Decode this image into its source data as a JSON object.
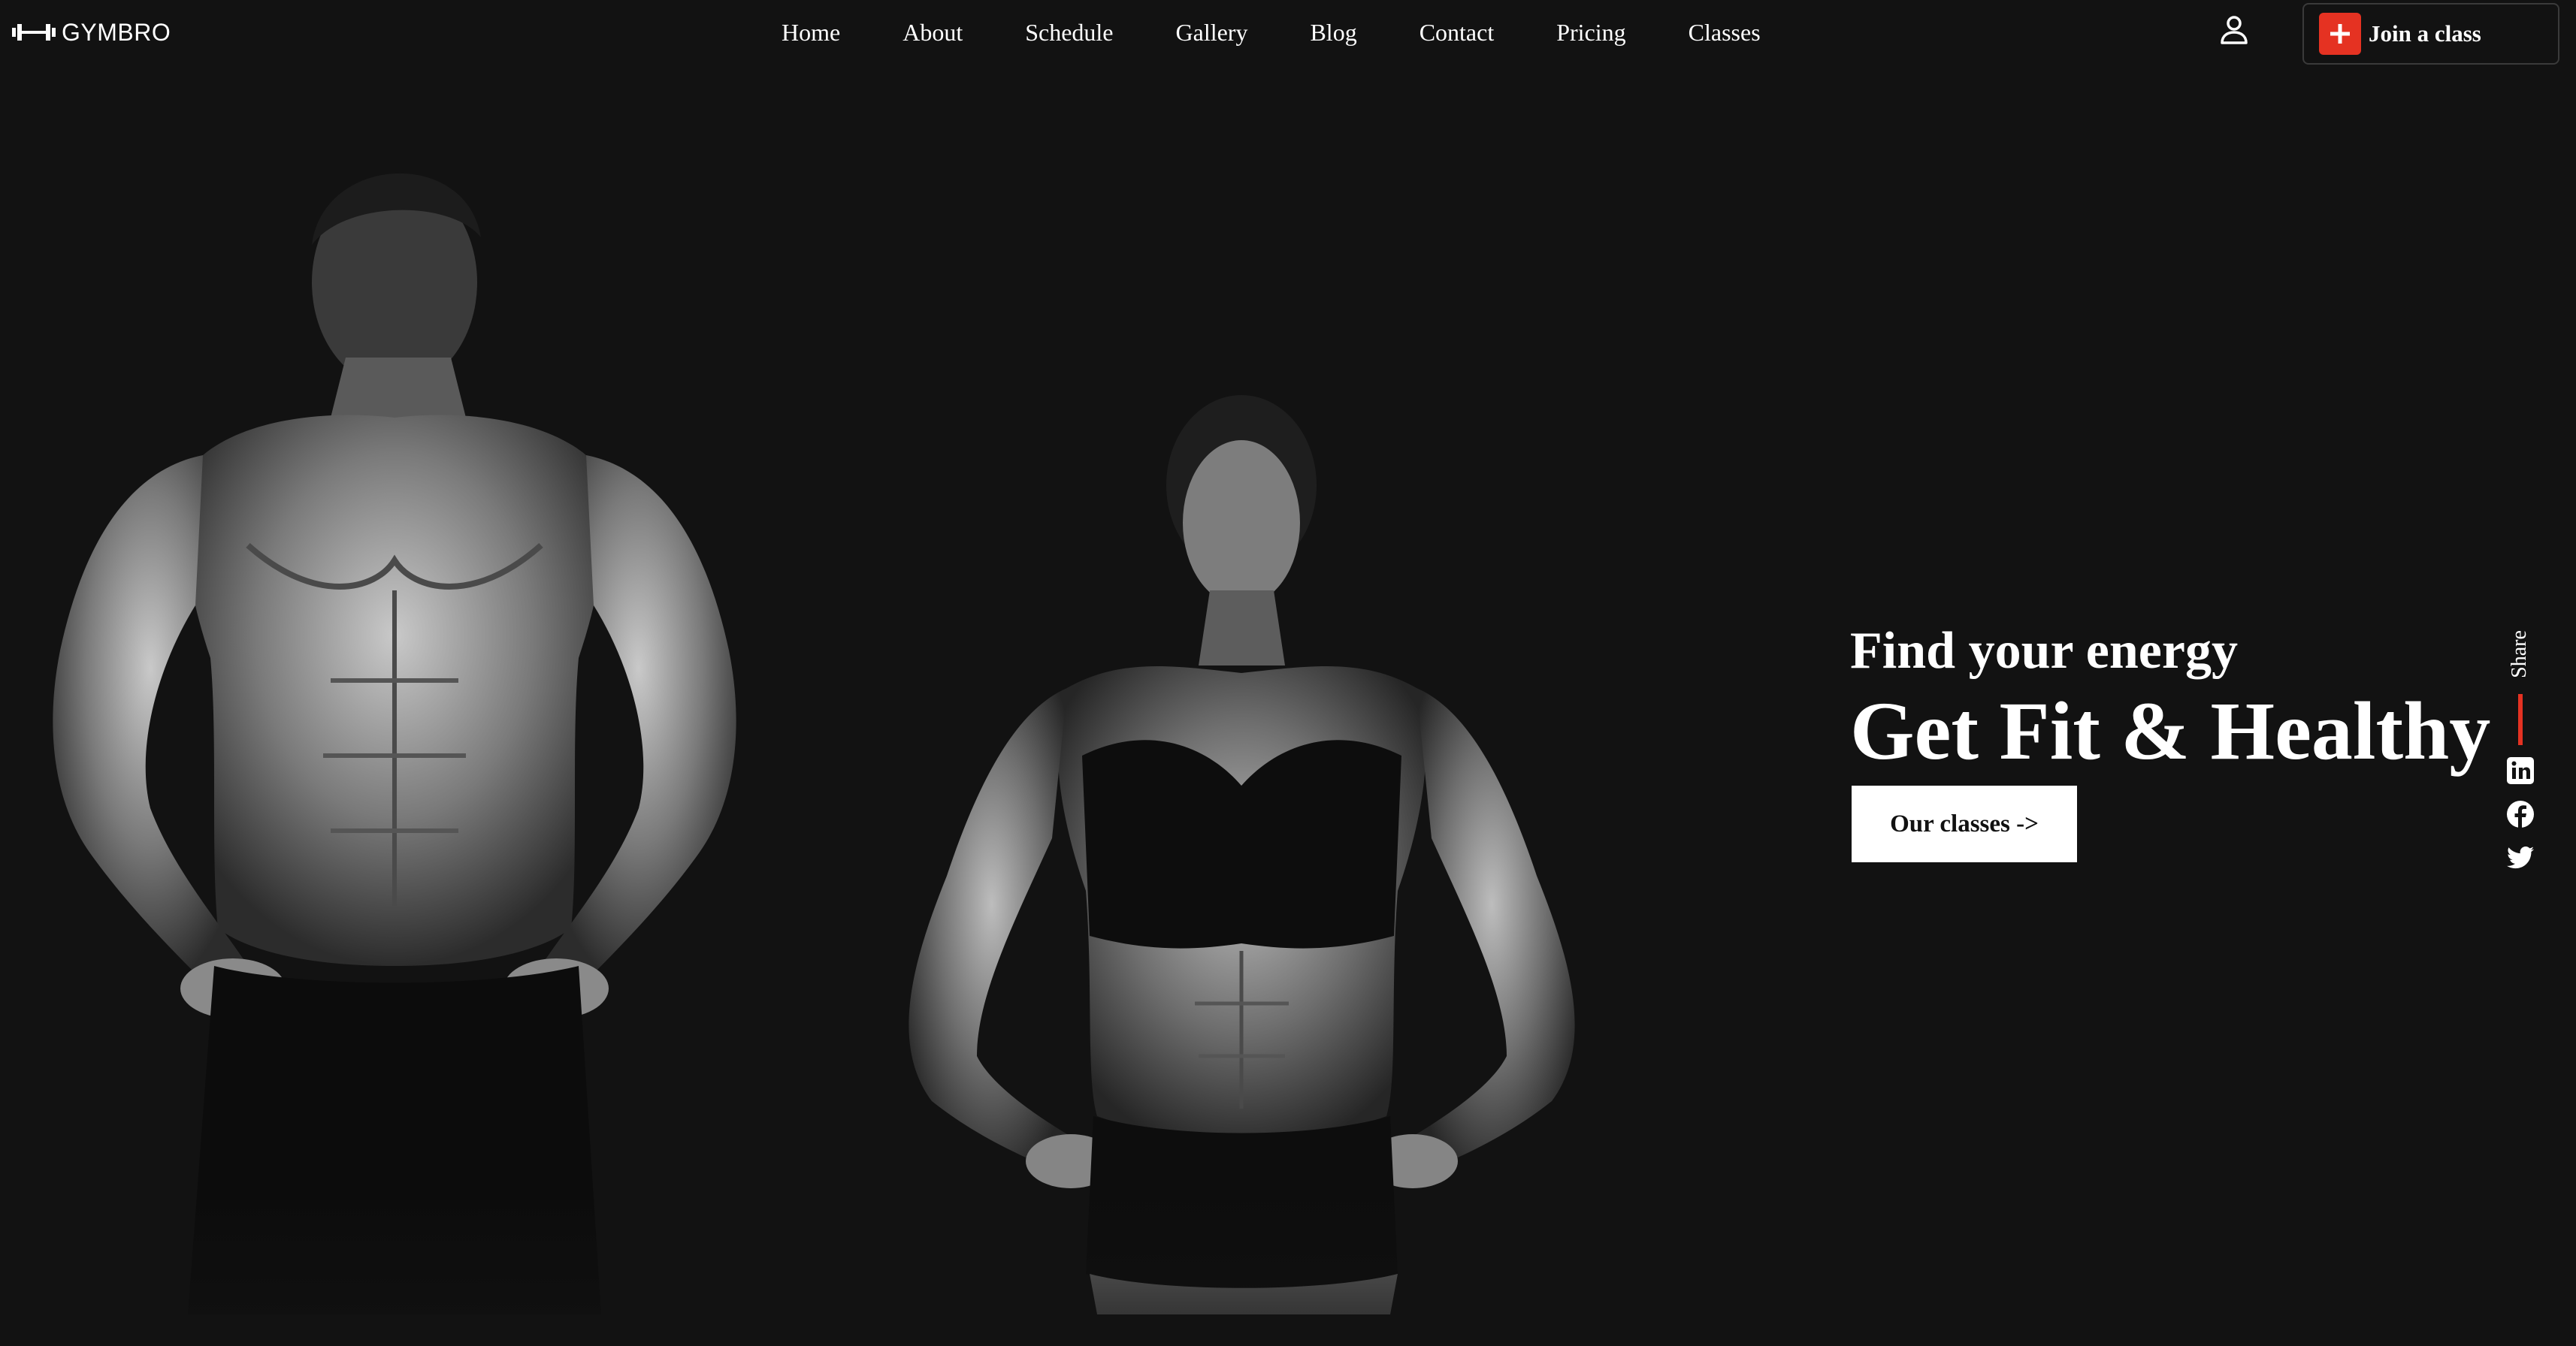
{
  "brand": {
    "logo_text": "GYMBRO",
    "logo_icon": "dumbbell-icon"
  },
  "nav": {
    "items": [
      "Home",
      "About",
      "Schedule",
      "Gallery",
      "Blog",
      "Contact",
      "Pricing",
      "Classes"
    ]
  },
  "header": {
    "user_icon": "user-icon",
    "join_label": "Join a class",
    "join_icon": "plus-icon"
  },
  "hero": {
    "subtitle": "Find your energy",
    "title": "Get Fit & Healthy",
    "cta_label": "Our classes ->"
  },
  "share": {
    "label": "Share",
    "icons": [
      "linkedin-icon",
      "facebook-icon",
      "twitter-icon"
    ]
  },
  "colors": {
    "background": "#121212",
    "accent": "#e53222",
    "text": "#ffffff",
    "button_bg": "#ffffff"
  }
}
